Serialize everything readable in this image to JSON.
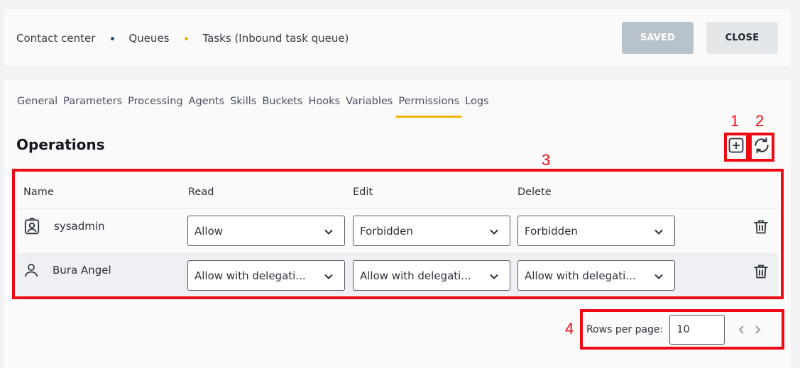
{
  "breadcrumb": [
    "Contact center",
    "Queues",
    "Tasks (Inbound task queue)"
  ],
  "header": {
    "saved_label": "SAVED",
    "close_label": "CLOSE"
  },
  "tabs": [
    "General",
    "Parameters",
    "Processing",
    "Agents",
    "Skills",
    "Buckets",
    "Hooks",
    "Variables",
    "Permissions",
    "Logs"
  ],
  "active_tab": "Permissions",
  "section": {
    "title": "Operations"
  },
  "table": {
    "columns": [
      "Name",
      "Read",
      "Edit",
      "Delete"
    ],
    "rows": [
      {
        "icon": "user-badge-icon",
        "name": "sysadmin",
        "read": "Allow",
        "edit": "Forbidden",
        "delete": "Forbidden"
      },
      {
        "icon": "user-icon",
        "name": "Bura Angel",
        "read": "Allow with delegati...",
        "edit": "Allow with delegati...",
        "delete": "Allow with delegati..."
      }
    ]
  },
  "pagination": {
    "rows_per_page_label": "Rows per page:",
    "rows_per_page": "10"
  },
  "annotations": [
    "1",
    "2",
    "3",
    "4"
  ],
  "colors": {
    "accent": "#f2b400",
    "annotation": "#ee0a15",
    "saved_bg": "#b8c2ca"
  }
}
